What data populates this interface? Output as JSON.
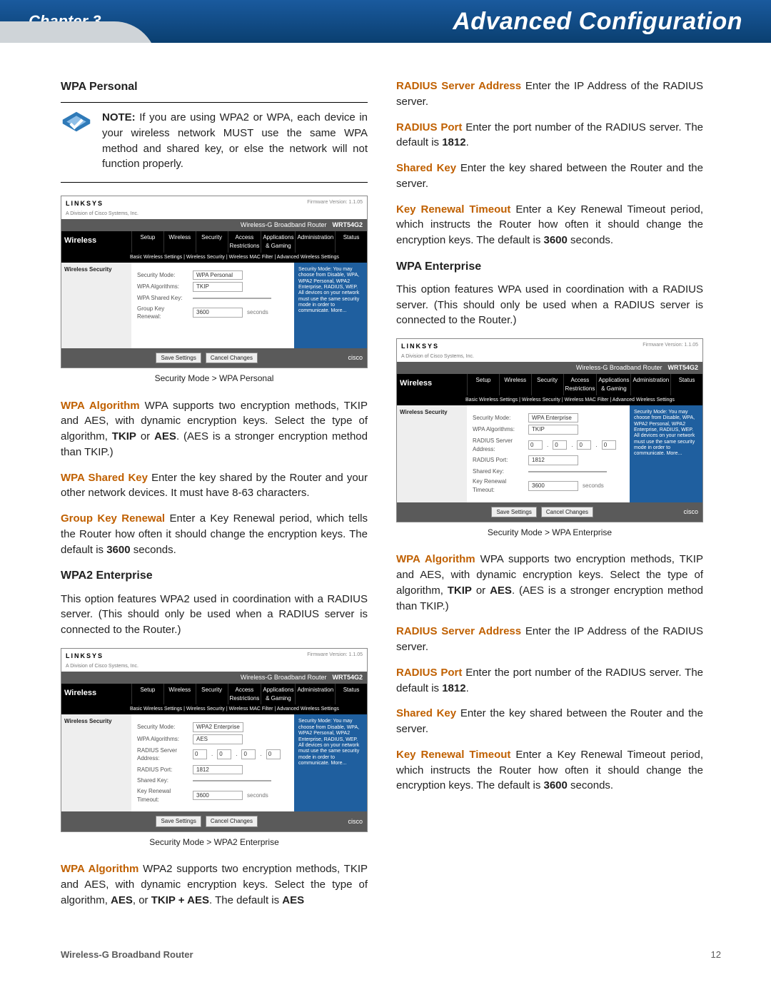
{
  "header": {
    "chapter": "Chapter 3",
    "title": "Advanced Configuration"
  },
  "left": {
    "h_wpa_personal": "WPA Personal",
    "note_lead": "NOTE:",
    "note_body": "If you are using WPA2 or WPA, each device in your wireless network MUST use the same WPA method and shared key, or else the network will not function properly.",
    "caption_personal": "Security Mode > WPA Personal",
    "p1_lead": "WPA Algorithm",
    "p1_body": " WPA supports two encryption methods, TKIP and AES, with dynamic encryption keys. Select the type of algorithm, ",
    "p1_bold1": "TKIP",
    "p1_mid": " or ",
    "p1_bold2": "AES",
    "p1_tail": ". (AES is a stronger encryption method than TKIP.)",
    "p2_lead": "WPA Shared Key",
    "p2_body": "  Enter the key shared by the Router and your other network devices. It must have 8-63 characters.",
    "p3_lead": "Group Key Renewal",
    "p3_body": " Enter a Key Renewal period, which tells the Router how often it should change the encryption keys. The default is ",
    "p3_bold": "3600",
    "p3_tail": " seconds.",
    "h_wpa2_ent": "WPA2 Enterprise",
    "p4": "This option features WPA2 used in coordination with a RADIUS server. (This should only be used when a RADIUS server is connected to the Router.)",
    "caption_wpa2ent": "Security Mode > WPA2 Enterprise",
    "p5_lead": "WPA Algorithm",
    "p5_body": "  WPA2 supports two encryption methods, TKIP and AES, with dynamic encryption keys. Select the type of algorithm, ",
    "p5_bold1": "AES",
    "p5_mid": ", or ",
    "p5_bold2": "TKIP + AES",
    "p5_tail": ". The default is ",
    "p5_bold3": "AES"
  },
  "right": {
    "p1_lead": "RADIUS Server Address",
    "p1_body": " Enter the IP Address of the RADIUS server.",
    "p2_lead": "RADIUS Port",
    "p2_body": "  Enter the port number of the RADIUS server. The default is ",
    "p2_bold": "1812",
    "p2_tail": ".",
    "p3_lead": "Shared Key",
    "p3_body": " Enter the key shared between the Router and the server.",
    "p4_lead": "Key Renewal Timeout",
    "p4_body": " Enter a Key Renewal Timeout period, which instructs the Router how often it should change the encryption keys. The default is ",
    "p4_bold": "3600",
    "p4_tail": " seconds.",
    "h_wpa_ent": "WPA Enterprise",
    "p5": "This option features WPA used in coordination with a RADIUS server. (This should only be used when a RADIUS server is connected to the Router.)",
    "caption_wpaent": "Security Mode > WPA Enterprise",
    "p6_lead": "WPA Algorithm",
    "p6_body": " WPA supports two encryption methods, TKIP and AES, with dynamic encryption keys. Select the type of algorithm, ",
    "p6_bold1": "TKIP",
    "p6_mid": " or ",
    "p6_bold2": "AES",
    "p6_tail": ". (AES is a stronger encryption method than TKIP.)",
    "p7_lead": "RADIUS Server Address",
    "p7_body": " Enter the IP Address of the RADIUS server.",
    "p8_lead": "RADIUS Port",
    "p8_body": "  Enter the port number of the RADIUS server. The default is ",
    "p8_bold": "1812",
    "p8_tail": ".",
    "p9_lead": "Shared Key",
    "p9_body": " Enter the key shared between the Router and the server.",
    "p10_lead": "Key Renewal Timeout",
    "p10_body": " Enter a Key Renewal Timeout period, which instructs the Router how often it should change the encryption keys. The default is ",
    "p10_bold": "3600",
    "p10_tail": " seconds."
  },
  "shot_common": {
    "brand": "LINKSYS",
    "sub": "A Division of Cisco Systems, Inc.",
    "fw": "Firmware Version: 1.1.05",
    "model_line": "Wireless-G Broadband Router",
    "model": "WRT54G2",
    "side": "Wireless",
    "tabs": [
      "Setup",
      "Wireless",
      "Security",
      "Access Restrictions",
      "Applications & Gaming",
      "Administration",
      "Status"
    ],
    "subnav": "Basic Wireless Settings  |  Wireless Security  |  Wireless MAC Filter  |  Advanced Wireless Settings",
    "panel_label": "Wireless Security",
    "help": "Security Mode: You may choose from Disable, WPA, WPA2 Personal, WPA2 Enterprise, RADIUS, WEP. All devices on your network must use the same security mode in order to communicate. More...",
    "save": "Save Settings",
    "cancel": "Cancel Changes",
    "cisco": "cisco"
  },
  "shot_personal": {
    "rows": {
      "mode_label": "Security Mode:",
      "mode_value": "WPA Personal",
      "alg_label": "WPA Algorithms:",
      "alg_value": "TKIP",
      "key_label": "WPA Shared Key:",
      "key_value": "",
      "grp_label": "Group Key Renewal:",
      "grp_value": "3600",
      "grp_unit": "seconds"
    }
  },
  "shot_wpa2ent": {
    "rows": {
      "mode_label": "Security Mode:",
      "mode_value": "WPA2 Enterprise",
      "alg_label": "WPA Algorithms:",
      "alg_value": "AES",
      "addr_label": "RADIUS Server Address:",
      "addr_oct": [
        "0",
        "0",
        "0",
        "0"
      ],
      "port_label": "RADIUS Port:",
      "port_value": "1812",
      "skey_label": "Shared Key:",
      "skey_value": "",
      "ren_label": "Key Renewal Timeout:",
      "ren_value": "3600",
      "ren_unit": "seconds"
    }
  },
  "shot_wpaent": {
    "rows": {
      "mode_label": "Security Mode:",
      "mode_value": "WPA Enterprise",
      "alg_label": "WPA Algorithms:",
      "alg_value": "TKIP",
      "addr_label": "RADIUS Server Address:",
      "addr_oct": [
        "0",
        "0",
        "0",
        "0"
      ],
      "port_label": "RADIUS Port:",
      "port_value": "1812",
      "skey_label": "Shared Key:",
      "skey_value": "",
      "ren_label": "Key Renewal Timeout:",
      "ren_value": "3600",
      "ren_unit": "seconds"
    }
  },
  "footer": {
    "product": "Wireless-G Broadband Router",
    "page": "12"
  }
}
